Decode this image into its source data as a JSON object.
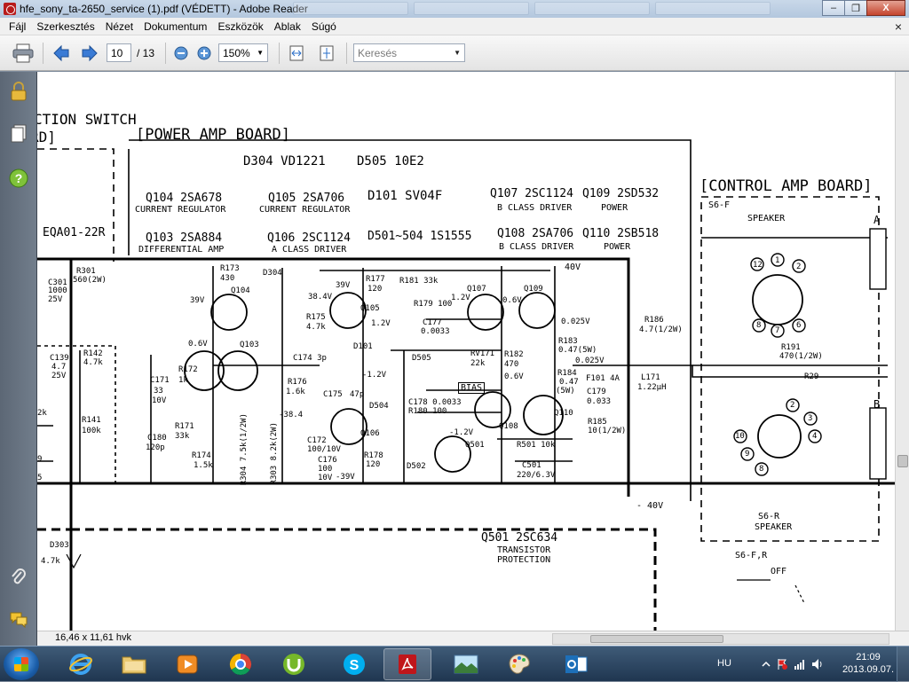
{
  "window": {
    "title": "hfe_sony_ta-2650_service (1).pdf (VÉDETT) - Adobe Reader",
    "buttons": {
      "minimize": "–",
      "maximize": "❐",
      "close": "X"
    }
  },
  "menu": {
    "items": [
      "Fájl",
      "Szerkesztés",
      "Nézet",
      "Dokumentum",
      "Eszközök",
      "Ablak",
      "Súgó"
    ],
    "close_glyph": "×"
  },
  "toolbar": {
    "current_page": "10",
    "page_separator": "/ 13",
    "zoom": "150%",
    "search_placeholder": "Keresés"
  },
  "status": {
    "page_dimensions": "16,46 x 11,61 hvk"
  },
  "taskbar": {
    "apps": [
      "internet-explorer",
      "file-explorer",
      "media-player",
      "chrome",
      "utorrent",
      "skype",
      "adobe-reader",
      "photo-viewer",
      "paint",
      "outlook"
    ],
    "active_app": "adobe-reader",
    "language": "HU",
    "time": "21:09",
    "date": "2013.09.07."
  },
  "schematic": {
    "labels": {
      "section_switch": "CTION SWITCH",
      "section_switch_tail": "RD]",
      "power_amp_board": "[POWER AMP BOARD]",
      "control_amp_board": "[CONTROL AMP BOARD]",
      "d304": "D304 VD1221",
      "d505": "D505 10E2",
      "q104": "Q104 2SA678",
      "q104_role": "CURRENT REGULATOR",
      "q105": "Q105 2SA706",
      "q105_role": "CURRENT REGULATOR",
      "d101": "D101 SV04F",
      "q107": "Q107 2SC1124",
      "q107_role": "B CLASS DRIVER",
      "q109": "Q109 2SD532",
      "q109_role": "POWER",
      "q103": "Q103 2SA884",
      "q103_role": "DIFFERENTIAL AMP",
      "q106": "Q106 2SC1124",
      "q106_role": "A CLASS DRIVER",
      "d501": "D501~504 1S1555",
      "q108": "Q108 2SA706",
      "q108_role": "B CLASS DRIVER",
      "q110": "Q110 2SB518",
      "q110_role": "POWER",
      "eqa": "EQA01-22R",
      "q501": "Q501 2SC634",
      "q501_role_1": "TRANSISTOR",
      "q501_role_2": "PROTECTION",
      "s6f": "S6-F",
      "s6f_role": "SPEAKER",
      "s6r": "S6-R",
      "s6r_role": "SPEAKER",
      "s6fr": "S6-F,R",
      "off": "OFF",
      "plug_a": "A",
      "plug_b": "B",
      "plus40": "40V",
      "minus40": "- 40V",
      "bias": "BIAS",
      "r301": "R301",
      "r301_val": "560(2W)",
      "c301": "C301",
      "c301_val": "1000",
      "c301_v": "25V",
      "r173": "R173",
      "r173_val": "430",
      "r177": "R177",
      "r177_val": "120",
      "r181": "R181 33k",
      "r179": "R179 100",
      "v39": "39V",
      "v384": "38.4V",
      "v12": "1.2V",
      "v06": "0.6V",
      "v0025": "0.025V",
      "r186": "R186",
      "r186_val": "4.7(1/2W)",
      "r175": "R175",
      "r175_val": "4.7k",
      "c177": "C177",
      "c177_val": "0.0033",
      "r183": "R183",
      "r183_val": "0.47(5W)",
      "r191": "R191",
      "r191_val": "470(1/2W)",
      "r142": "R142",
      "r142_val": "4.7k",
      "c171": "C171",
      "c171_val": "33",
      "c171_v": "10V",
      "r172": "R172",
      "r172_val": "1k",
      "c174": "C174 3p",
      "r176": "R176",
      "r176_val": "1.6k",
      "c175": "C175",
      "c175_val": "47p",
      "v_12": "-1.2V",
      "d505b": "D505",
      "rv171": "RV171",
      "rv171_val": "22k",
      "r182": "R182",
      "r182_val": "470",
      "r184": "R184",
      "r184_val": "0.47",
      "r184_w": "(5W)",
      "f101": "F101 4A",
      "c179": "C179",
      "c179_val": "0.033",
      "l171": "L171",
      "l171_val": "1.22μH",
      "r141": "R141",
      "r141_val": "100k",
      "c180": "C180",
      "c180_val": "120p",
      "r171": "R171",
      "r171_val": "33k",
      "v_384": "-38.4",
      "c178": "C178 0.0033",
      "r180": "R180 100",
      "c172": "C172",
      "c172_val": "100/10V",
      "c176": "C176",
      "c176_val": "100",
      "c176_v": "10V",
      "r185": "R185",
      "r185_val": "10(1/2W)",
      "r174": "R174",
      "r174_val": "1.5k",
      "r304": "R304 7.5k(1/2W)",
      "r303": "R303 8.2k(2W)",
      "r178": "R178",
      "r178_val": "120",
      "v_39": "-39V",
      "r501": "R501 10k",
      "c501": "C501",
      "c501_val": "220/6.3V",
      "d502": "D502",
      "d303": "D303",
      "r47k": "4.7k",
      "c139": "C139",
      "c139_val": "4.7",
      "c139_v": "25V",
      "q104_tag": "Q104",
      "q105_tag": "Q105",
      "q103_tag": "Q103",
      "q106_tag": "Q106",
      "q107_tag": "Q107",
      "q108_tag": "Q108",
      "q109_tag": "Q109",
      "q110_tag": "Q110",
      "q501_tag": "Q501",
      "d304_tag": "D304",
      "d101_tag": "D101",
      "d504_tag": "D504",
      "pin1": "1",
      "pin2": "2",
      "pin3": "3",
      "pin4": "4",
      "pin6": "6",
      "pin7": "7",
      "pin8": "8",
      "pin9": "9",
      "pin10": "10",
      "pin12": "12",
      "r29": "R29",
      "v_minus12": "-1.2V",
      "v06b": "0.6V",
      "cut1": "2k",
      "cut2": "9",
      "cut3": "5",
      "r182b": "R182"
    }
  }
}
